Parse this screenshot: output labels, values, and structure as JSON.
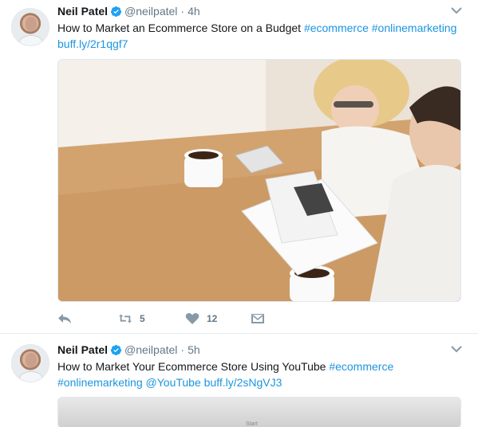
{
  "tweets": [
    {
      "author": {
        "name": "Neil Patel",
        "handle": "@neilpatel",
        "separator": "·",
        "time": "4h"
      },
      "text": {
        "main": "How to Market an Ecommerce Store on a Budget ",
        "hashtag1": "#ecommerce",
        "hashtag2": "#onlinemarketing",
        "url": "buff.ly/2r1qgf7"
      },
      "image_alt": "Woman and man looking at documents with coffee cups on wooden table",
      "actions": {
        "retweets": "5",
        "likes": "12"
      }
    },
    {
      "author": {
        "name": "Neil Patel",
        "handle": "@neilpatel",
        "separator": "·",
        "time": "5h"
      },
      "text": {
        "main": "How to Market Your Ecommerce Store Using YouTube ",
        "hashtag1": "#ecommerce",
        "hashtag2": "#onlinemarketing",
        "mention": "@YouTube",
        "url": "buff.ly/2sNgVJ3"
      },
      "image_partial_text": "Start"
    }
  ],
  "icons": [
    "verified-icon",
    "chevron-down-icon",
    "reply-icon",
    "retweet-icon",
    "like-icon",
    "direct-message-icon"
  ],
  "colors": {
    "link": "#1b95e0",
    "verified": "#1da1f2",
    "meta": "#657786",
    "divider": "#e6ecf0"
  }
}
